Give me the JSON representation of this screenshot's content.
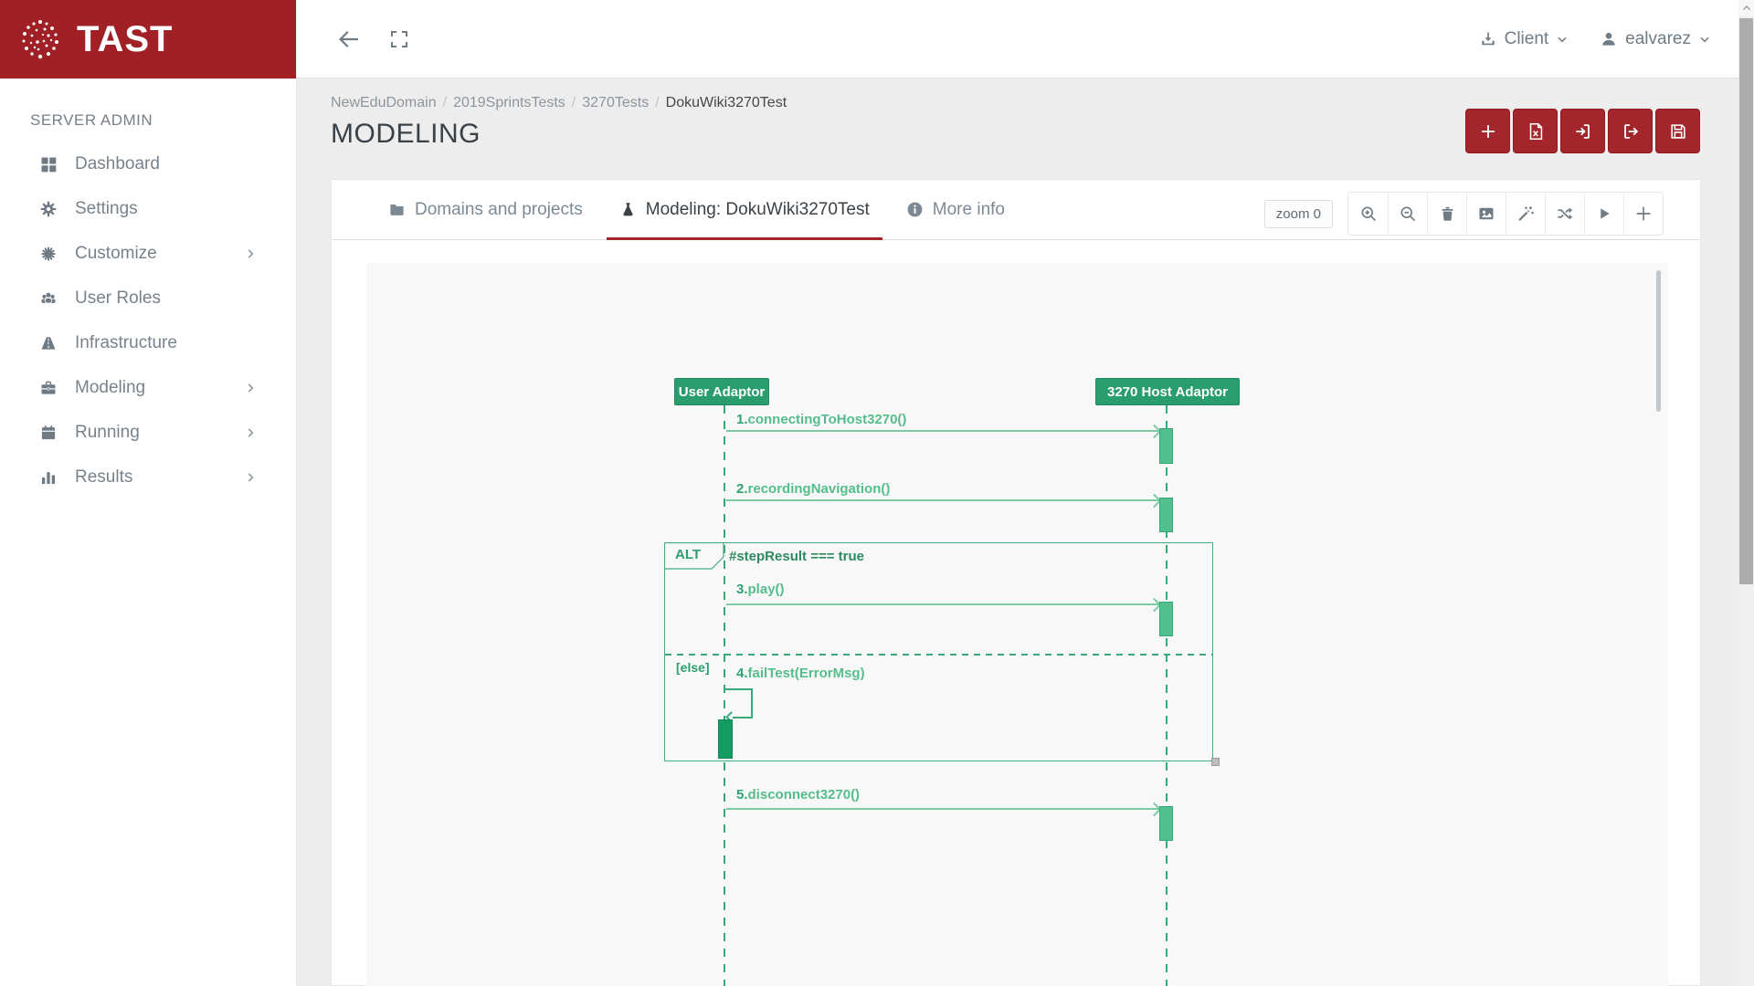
{
  "brand": {
    "title": "TAST"
  },
  "topbar": {
    "client_label": "Client",
    "user_label": "ealvarez"
  },
  "sidebar": {
    "section": "SERVER ADMIN",
    "items": [
      {
        "label": "Dashboard",
        "icon": "dashboard-icon",
        "has_submenu": false
      },
      {
        "label": "Settings",
        "icon": "gear-icon",
        "has_submenu": false
      },
      {
        "label": "Customize",
        "icon": "cog-burst-icon",
        "has_submenu": true
      },
      {
        "label": "User Roles",
        "icon": "users-icon",
        "has_submenu": false
      },
      {
        "label": "Infrastructure",
        "icon": "road-icon",
        "has_submenu": false
      },
      {
        "label": "Modeling",
        "icon": "briefcase-icon",
        "has_submenu": true
      },
      {
        "label": "Running",
        "icon": "calendar-icon",
        "has_submenu": true
      },
      {
        "label": "Results",
        "icon": "bar-chart-icon",
        "has_submenu": true
      }
    ]
  },
  "breadcrumb": {
    "sep": "/",
    "items": [
      "NewEduDomain",
      "2019SprintsTests",
      "3270Tests",
      "DokuWiki3270Test"
    ]
  },
  "page": {
    "title": "MODELING"
  },
  "actions": [
    {
      "icon": "plus-icon"
    },
    {
      "icon": "file-excel-icon"
    },
    {
      "icon": "sign-in-icon"
    },
    {
      "icon": "sign-out-icon"
    },
    {
      "icon": "save-icon"
    }
  ],
  "tabs": [
    {
      "label": "Domains and projects",
      "icon": "folder-icon",
      "active": false
    },
    {
      "label": "Modeling: DokuWiki3270Test",
      "icon": "flask-icon",
      "active": true
    },
    {
      "label": "More info",
      "icon": "info-icon",
      "active": false
    }
  ],
  "toolbar": {
    "zoom_badge": "zoom 0",
    "buttons": [
      {
        "icon": "zoom-in-icon"
      },
      {
        "icon": "zoom-out-icon"
      },
      {
        "icon": "trash-icon"
      },
      {
        "icon": "image-icon"
      },
      {
        "icon": "magic-wand-icon"
      },
      {
        "icon": "shuffle-icon"
      },
      {
        "icon": "play-icon"
      },
      {
        "icon": "plus-icon"
      }
    ]
  },
  "diagram": {
    "actors": [
      {
        "name": "User Adaptor"
      },
      {
        "name": "3270 Host Adaptor"
      }
    ],
    "messages": [
      {
        "num": "1.",
        "name": "connectingToHost3270()"
      },
      {
        "num": "2.",
        "name": "recordingNavigation()"
      },
      {
        "num": "3.",
        "name": "play()"
      },
      {
        "num": "4.",
        "name": "failTest(ErrorMsg)"
      },
      {
        "num": "5.",
        "name": "disconnect3270()"
      }
    ],
    "fragment": {
      "operator": "ALT",
      "guard": "#stepResult === true",
      "else_guard": "[else]"
    }
  },
  "colors": {
    "brand-red": "#A12025",
    "accent-red": "#A2262B",
    "content-bg": "#EDEDEE",
    "canvas-bg": "#F8F8F8",
    "title-text": "#3A4147",
    "dg-actor": "#2A9D6F",
    "dg-line": "#7CCBA3",
    "dg-label": "#55BD8D",
    "dg-lifeline": "#3AA97A",
    "dg-frag-border": "#45AC7E",
    "dg-guard": "#2D8A60",
    "dg-act": "#52C08E",
    "dg-act-dark": "#149B62"
  }
}
